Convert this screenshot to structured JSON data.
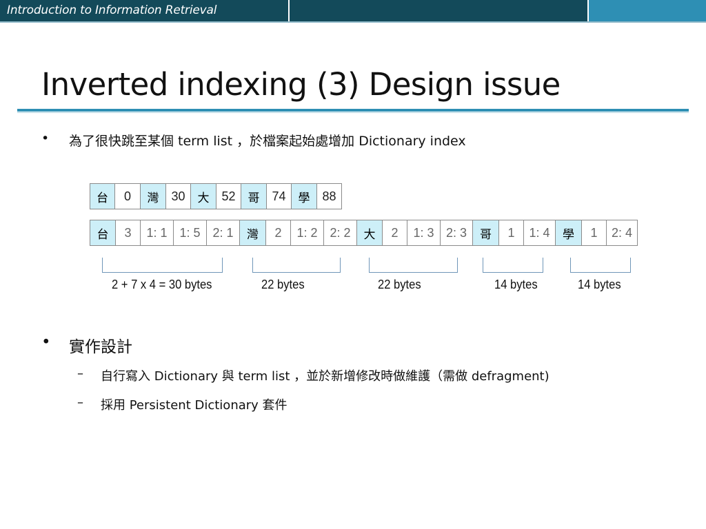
{
  "header": {
    "course_title": "Introduction to Information Retrieval"
  },
  "slide": {
    "title": "Inverted indexing (3) Design issue"
  },
  "bullets": {
    "b1_symbol": "•",
    "b1_text": "為了很快跳至某個 term list ，於檔案起始處增加 Dictionary index",
    "b2_symbol": "•",
    "b2_text": "實作設計",
    "sub_symbol": "–",
    "sub1_text": "自行寫入 Dictionary 與 term list ，並於新增修改時做維護（需做 defragment)",
    "sub2_text": "採用 Persistent Dictionary 套件"
  },
  "dictionary_index": [
    {
      "term": "台",
      "offset": "0"
    },
    {
      "term": "灣",
      "offset": "30"
    },
    {
      "term": "大",
      "offset": "52"
    },
    {
      "term": "哥",
      "offset": "74"
    },
    {
      "term": "學",
      "offset": "88"
    }
  ],
  "term_list_cells": [
    {
      "text": "台",
      "kind": "term"
    },
    {
      "text": "3",
      "kind": "num"
    },
    {
      "text": "1: 1",
      "kind": "num"
    },
    {
      "text": "1: 5",
      "kind": "num"
    },
    {
      "text": "2: 1",
      "kind": "num"
    },
    {
      "text": "灣",
      "kind": "term"
    },
    {
      "text": "2",
      "kind": "num"
    },
    {
      "text": "1: 2",
      "kind": "num"
    },
    {
      "text": "2: 2",
      "kind": "num"
    },
    {
      "text": "大",
      "kind": "term"
    },
    {
      "text": "2",
      "kind": "num"
    },
    {
      "text": "1: 3",
      "kind": "num"
    },
    {
      "text": "2: 3",
      "kind": "num"
    },
    {
      "text": "哥",
      "kind": "term"
    },
    {
      "text": "1",
      "kind": "num"
    },
    {
      "text": "1: 4",
      "kind": "num"
    },
    {
      "text": "學",
      "kind": "term"
    },
    {
      "text": "1",
      "kind": "num"
    },
    {
      "text": "2: 4",
      "kind": "num"
    }
  ],
  "size_labels": [
    "2 + 7 x 4 = 30 bytes",
    "22 bytes",
    "22 bytes",
    "14 bytes",
    "14 bytes"
  ],
  "colors": {
    "header_dark": "#134a5a",
    "header_accent": "#2e8fb4",
    "term_cell_fill": "#cdeff8",
    "bracket": "#6f96b8"
  }
}
